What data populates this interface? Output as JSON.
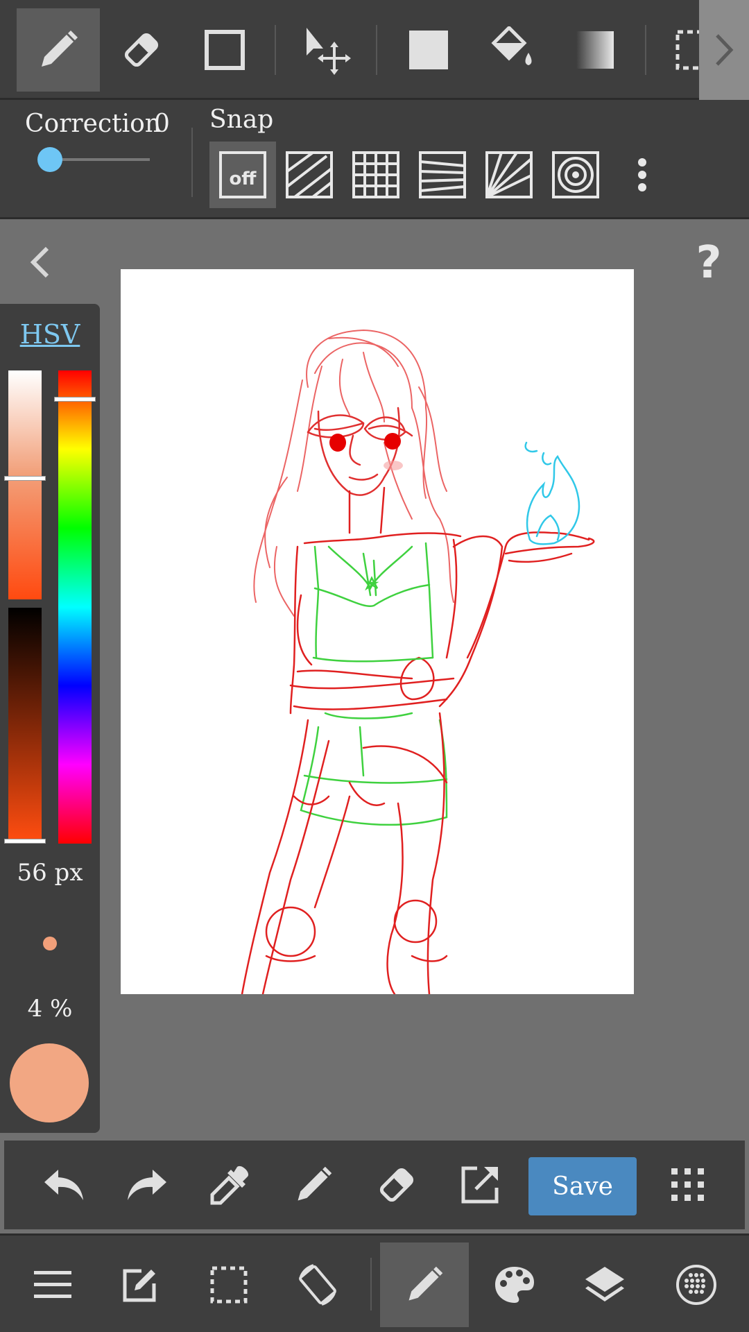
{
  "toolbar": {
    "tools": [
      {
        "name": "pen-icon",
        "selected": true
      },
      {
        "name": "eraser-icon",
        "selected": false
      },
      {
        "name": "rectangle-outline-icon",
        "selected": false
      },
      {
        "name": "move-icon",
        "selected": false
      },
      {
        "name": "fill-rectangle-icon",
        "selected": false
      },
      {
        "name": "bucket-fill-icon",
        "selected": false
      },
      {
        "name": "gradient-icon",
        "selected": false
      },
      {
        "name": "select-rectangle-icon",
        "selected": false
      }
    ],
    "more_icon": "chevron-right-icon"
  },
  "options": {
    "correction_label": "Correction",
    "correction_value": "0",
    "correction_level": 0,
    "snap_label": "Snap",
    "snap_off_label": "off",
    "snap_modes": [
      "snap-off",
      "snap-parallel",
      "snap-grid",
      "snap-perspective-lines",
      "snap-radial",
      "snap-concentric"
    ],
    "more_icon": "vertical-dots-icon"
  },
  "canvas": {
    "back_icon": "chevron-left-icon",
    "help_label": "?"
  },
  "color_panel": {
    "mode_tab": "HSV",
    "brush_size": "56 px",
    "opacity": "4 %",
    "current_color": "#f2a783",
    "hue_level": 0.06,
    "saturation_level": 0.47,
    "value_level": 1.0
  },
  "actions": {
    "items": [
      "undo-icon",
      "redo-icon",
      "eyedropper-icon",
      "pen-icon",
      "eraser-icon",
      "export-icon"
    ],
    "save_label": "Save",
    "grid_icon": "grid-dots-icon"
  },
  "bottom_nav": {
    "items": [
      {
        "name": "menu-icon",
        "selected": false
      },
      {
        "name": "edit-icon",
        "selected": false
      },
      {
        "name": "selection-icon",
        "selected": false
      },
      {
        "name": "rotate-canvas-icon",
        "selected": false
      },
      {
        "name": "brush-icon",
        "selected": true
      },
      {
        "name": "palette-icon",
        "selected": false
      },
      {
        "name": "layers-icon",
        "selected": false
      },
      {
        "name": "material-icon",
        "selected": false
      }
    ]
  },
  "colors": {
    "background": "#707070",
    "bar": "#3e3e3e",
    "accent": "#4a89c0",
    "slider_knob": "#6ec6f5",
    "sketch_red": "#e02020",
    "sketch_green": "#3fd13f",
    "sketch_cyan": "#30c8e8"
  }
}
